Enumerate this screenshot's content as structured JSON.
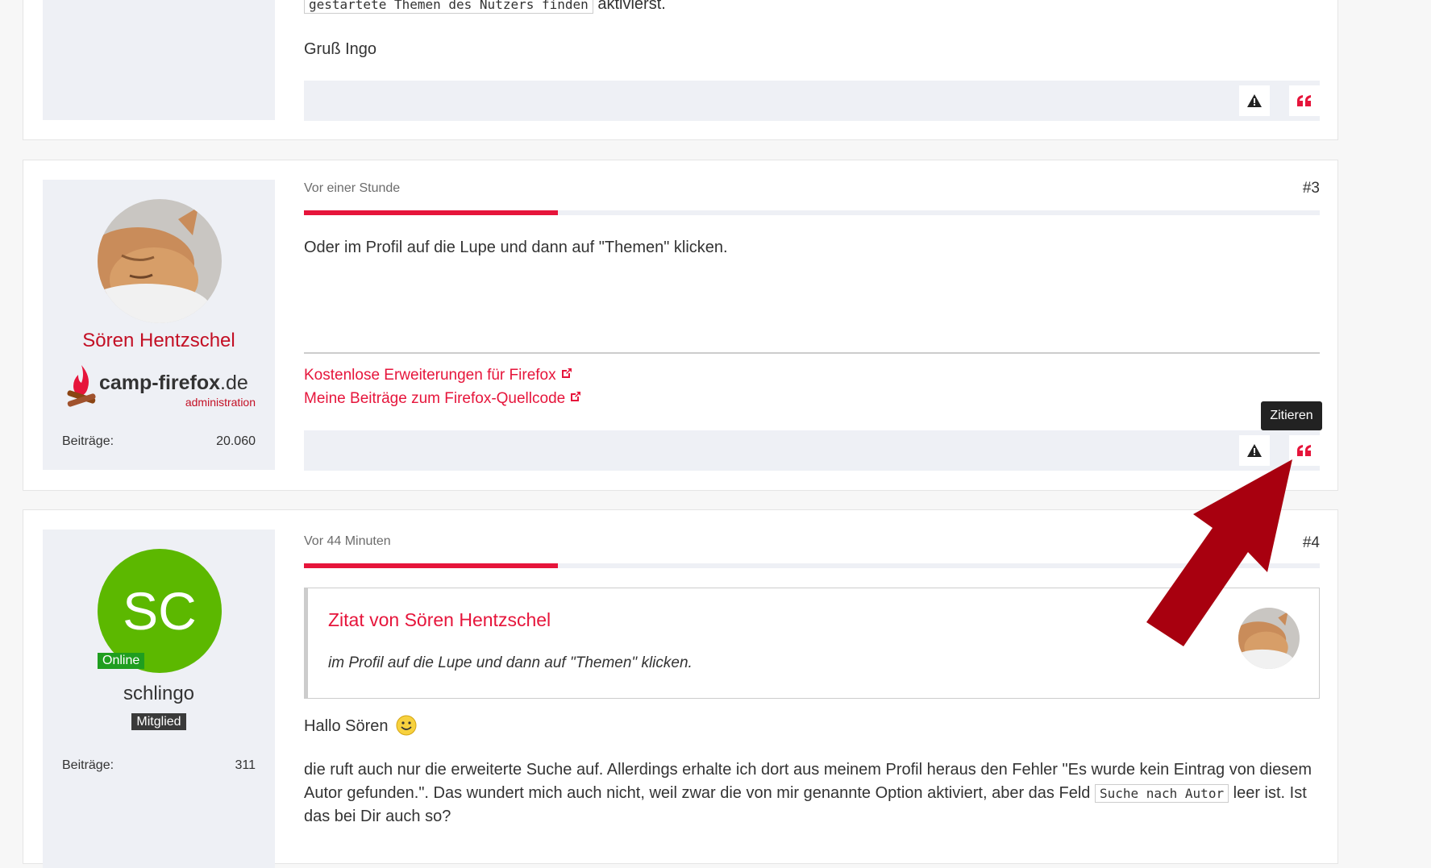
{
  "post2": {
    "code_snippet": "gestartete Themen des Nutzers finden",
    "code_after": "aktivierst.",
    "signoff": "Gruß Ingo"
  },
  "post3": {
    "time": "Vor einer Stunde",
    "number": "#3",
    "author": "Sören Hentzschel",
    "logo_text_camp": "camp-",
    "logo_text_firefox": "firefox",
    "logo_text_de": ".de",
    "logo_subtitle": "administration",
    "stat_label": "Beiträge:",
    "stat_value": "20.060",
    "body": "Oder im Profil auf die Lupe und dann auf \"Themen\" klicken.",
    "links": [
      "Kostenlose Erweiterungen für Firefox",
      "Meine Beiträge zum Firefox-Quellcode"
    ],
    "tooltip": "Zitieren",
    "read_progress": 0.25
  },
  "post4": {
    "time": "Vor 44 Minuten",
    "number": "#4",
    "avatar_initials": "SC",
    "online_badge": "Online",
    "author": "schlingo",
    "rank": "Mitglied",
    "stat_label": "Beiträge:",
    "stat_value": "311",
    "quote_title": "Zitat von Sören Hentzschel",
    "quote_text": "im Profil auf die Lupe und dann auf \"Themen\" klicken.",
    "greeting": "Hallo Sören",
    "body_part1": "die ruft auch nur die erweiterte Suche auf. Allerdings erhalte ich dort aus meinem Profil heraus den Fehler \"Es wurde kein Eintrag von diesem Autor gefunden.\". Das wundert mich auch nicht, weil zwar die von mir genannte Option aktiviert, aber das Feld",
    "code_field": "Suche nach Autor",
    "body_part2": "leer ist. Ist das bei Dir auch so?",
    "read_progress": 0.25
  },
  "colors": {
    "accent": "#e6153b",
    "arrow": "#a8000f",
    "online": "#1f9e1f",
    "avatar_green": "#5cb800"
  },
  "icons": {
    "report": "warning-triangle-icon",
    "quote": "quote-icon",
    "external": "external-link-icon",
    "smiley": "smiley-icon"
  }
}
